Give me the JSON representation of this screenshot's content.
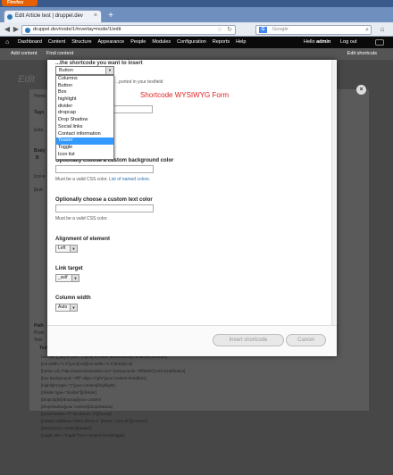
{
  "browser": {
    "app_button": "Firefox",
    "tab_title": "Edit Article test | druppel.dev",
    "tab_close": "×",
    "new_tab": "+",
    "url": "druppel.dev/node/1#overlay=node/1/edit",
    "search_engine": "Google",
    "search_placeholder": "Google"
  },
  "toolbar": {
    "items": [
      "Dashboard",
      "Content",
      "Structure",
      "Appearance",
      "People",
      "Modules",
      "Configuration",
      "Reports",
      "Help"
    ],
    "hello_prefix": "Hello",
    "username": "admin",
    "logout": "Log out",
    "shortcuts": [
      "Add content",
      "Find content"
    ],
    "edit_shortcuts": "Edit shortcuts"
  },
  "modal": {
    "header_fragment": "...the shortcode you want to insert",
    "selected_shortcode": "Button",
    "supported_text": "...ported in your textfield",
    "form_title": "Shortcode WYSIWYG Form",
    "options": [
      "Columns",
      "Button",
      "Box",
      "highlight",
      "divider",
      "dropcap",
      "Drop Shadow",
      "Social links",
      "Contact information",
      "Teaser",
      "Toggle",
      "Icon list"
    ],
    "highlighted_option": "Teaser",
    "bg_color_label": "Optionally choose a custom background color",
    "bg_color_hint": "Must be a valid CSS color.",
    "bg_color_link": "List of named colors.",
    "text_color_label": "Optionally choose a custom text color",
    "text_color_hint": "Must be a valid CSS color.",
    "alignment_label": "Alignment of element",
    "alignment_value": "Left",
    "link_target_label": "Link target",
    "link_target_value": "_self",
    "column_width_label": "Column width",
    "column_width_value": "Auto",
    "insert_button": "Insert shortcode",
    "cancel_button": "Cancel"
  },
  "background": {
    "edit_title": "Edit",
    "snippets": [
      "Home",
      "Tags",
      "Ente",
      "Body",
      "B",
      "[col w",
      "[butt",
      "Path",
      "Provi",
      "Text",
      "Text format"
    ],
    "bullet_lines": [
      "Use [tb, [_/tb] or {col-...} [box] to insert automatically rendered [buttons]",
      "[col width=\"1-2\"]your[/col][col width=\"1-2\"]tekst[/col]",
      "[button url=\"http://www.shortcodes.com\" background=\"#ff0000\"]Gold size[/button]",
      "[box background=\"#fff\" align=\"right\"]your content here[/box]",
      "[highlight type=\"1\"]your content[/highlight]",
      "[divider type=\"double\"][/divider]",
      "[dropcap]O[/dropcap]your content",
      "[dropshadow]your content[/dropshadow]",
      "[social twitter=\"#\" facebook=\"#\"][/social]",
      "[contact address=\"Main Street 1\" phone=\"123-45\"][/contact]",
      "[teaser]Your content[/teaser]",
      "[toggle title=\"Toggle\"]Your content here[/toggle]"
    ],
    "close_icon": "×"
  },
  "colors": {
    "toolbar_bg": "#0a0a0a",
    "overlay_bg": "#474747",
    "highlight": "#3399ff",
    "form_title": "#e02020",
    "link": "#2a6fb0",
    "firefox_orange": "#e66000"
  }
}
